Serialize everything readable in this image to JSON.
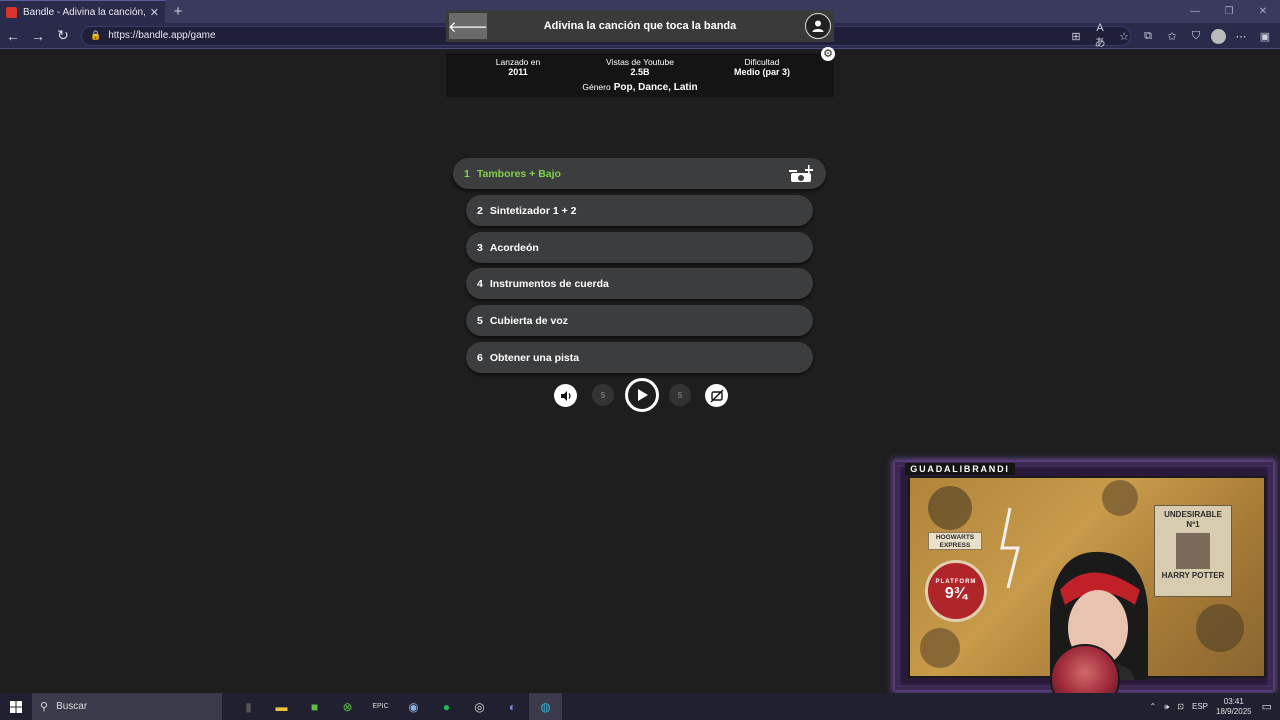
{
  "browser": {
    "tab_title": "Bandle - Adivina la canción, un ins",
    "tab_close": "✕",
    "new_tab": "+",
    "url": "https://bandle.app/game"
  },
  "header": {
    "title": "Adivina la canción que toca la banda"
  },
  "info": {
    "released_label": "Lanzado en",
    "released_value": "2011",
    "views_label": "Vistas de Youtube",
    "views_value": "2.5B",
    "difficulty_label": "Dificultad",
    "difficulty_value": "Medio (par 3)",
    "genre_label": "Género",
    "genre_value": "Pop, Dance, Latin"
  },
  "tracks": [
    {
      "num": "1",
      "label": "Tambores + Bajo"
    },
    {
      "num": "2",
      "label": "Sintetizador 1 + 2"
    },
    {
      "num": "3",
      "label": "Acordeón"
    },
    {
      "num": "4",
      "label": "Instrumentos de cuerda"
    },
    {
      "num": "5",
      "label": "Cubierta de voz"
    },
    {
      "num": "6",
      "label": "Obtener una pista"
    }
  ],
  "controls": {
    "rewind_label": "5",
    "forward_label": "5"
  },
  "webcam": {
    "streamer_name": "GUADALIBRANDI",
    "poster_title": "UNDESIRABLE",
    "poster_no": "Nº1",
    "poster_name": "HARRY POTTER",
    "sign_hogwarts": "HOGWARTS EXPRESS",
    "sign_platform": "PLATFORM",
    "sign_number": "9¾"
  },
  "taskbar": {
    "search_placeholder": "Buscar",
    "language": "ESP",
    "time": "03:41",
    "date": "18/9/2025"
  },
  "colors": {
    "accent_green": "#7fd24a",
    "track_bg": "#3c3d3f",
    "page_bg": "#1e1e1e"
  }
}
